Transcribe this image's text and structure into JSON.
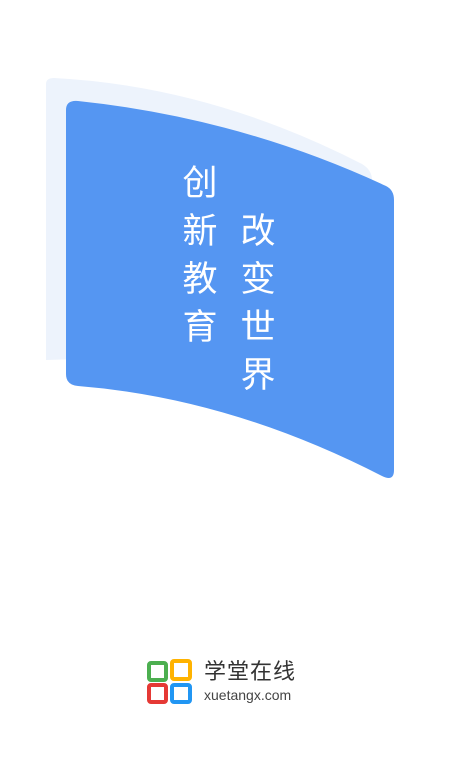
{
  "splash": {
    "slogan_right_column": [
      "创",
      "新",
      "教",
      "育"
    ],
    "slogan_left_column": [
      "改",
      "变",
      "世",
      "界"
    ]
  },
  "brand": {
    "name": "学堂在线",
    "domain": "xuetangx.com",
    "logo_icon": "four-squares-logo-icon",
    "logo_colors": [
      "#4CAF50",
      "#FFB300",
      "#E53935",
      "#2196F3"
    ]
  },
  "colors": {
    "panel_blue": "#5596F2",
    "panel_shadow": "#EDF3FC",
    "background": "#FFFFFF"
  }
}
